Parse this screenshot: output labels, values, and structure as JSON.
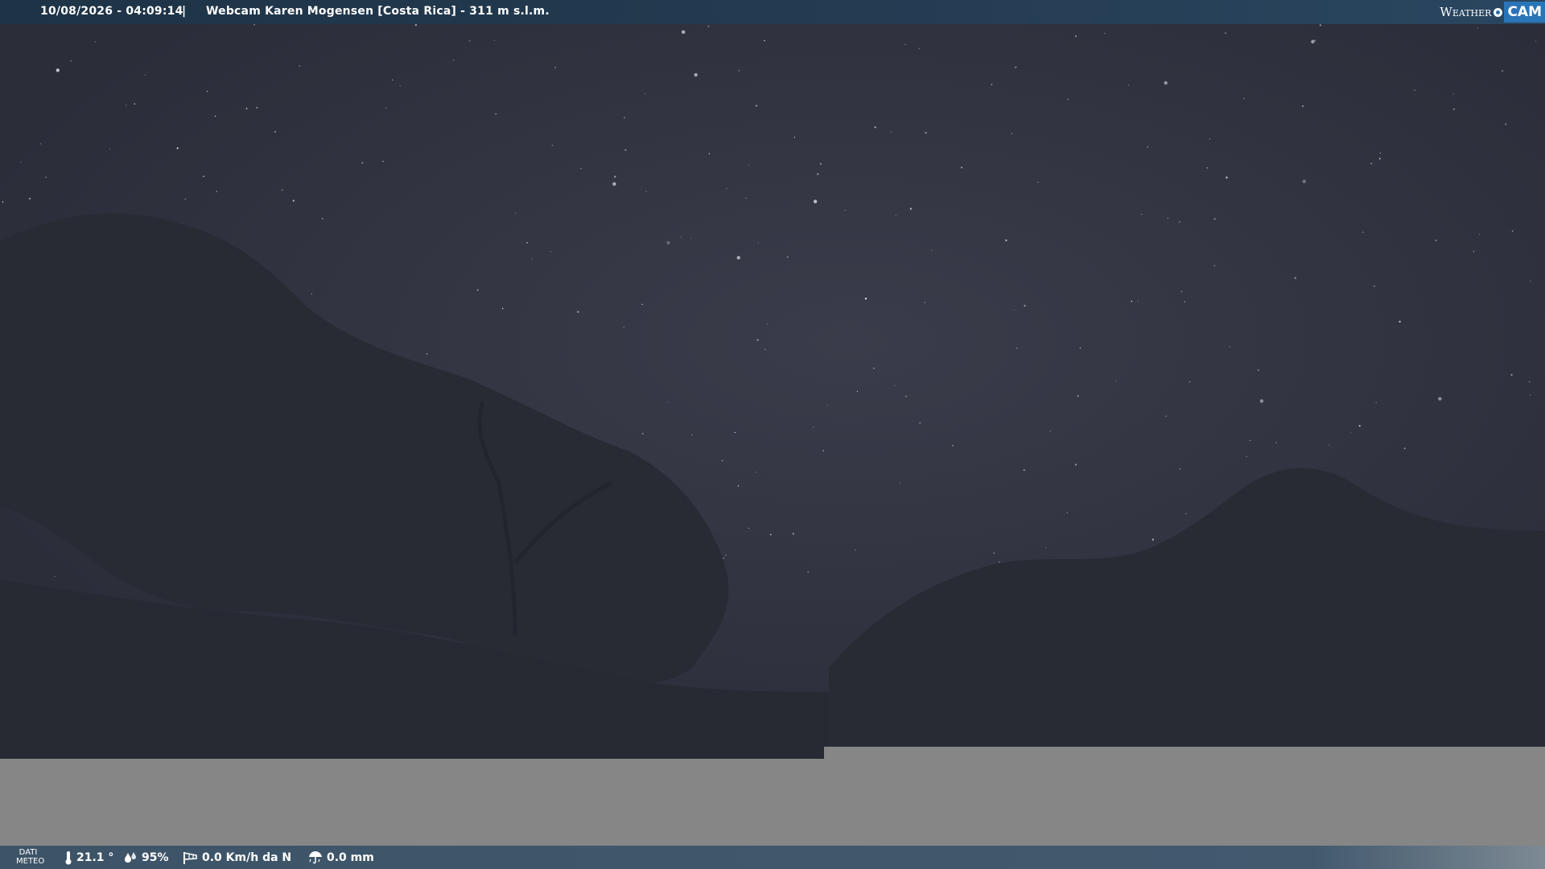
{
  "header": {
    "datetime": "10/08/2026 - 04:09:14",
    "separator": "|",
    "title": "Webcam Karen Mogensen [Costa Rica]  - 311 m s.l.m."
  },
  "logo": {
    "weather_text": "Weather",
    "cam_text": "CAM"
  },
  "weather_bar": {
    "label_line1": "DATI",
    "label_line2": "METEO",
    "temperature": "21.1 °",
    "humidity": "95%",
    "wind": "0.0 Km/h da N",
    "rain": "0.0 mm"
  },
  "icons": {
    "temperature": "thermometer-icon",
    "humidity": "humidity-drops-icon",
    "wind": "wind-sock-icon",
    "rain": "rain-umbrella-icon"
  },
  "colors": {
    "sky": "#2f313e",
    "silhouette": "#262832",
    "top_bar": "#233a50",
    "bottom_bar": "#3d5468",
    "logo_cam": "#2a74b8",
    "empty_area": "#868686"
  }
}
